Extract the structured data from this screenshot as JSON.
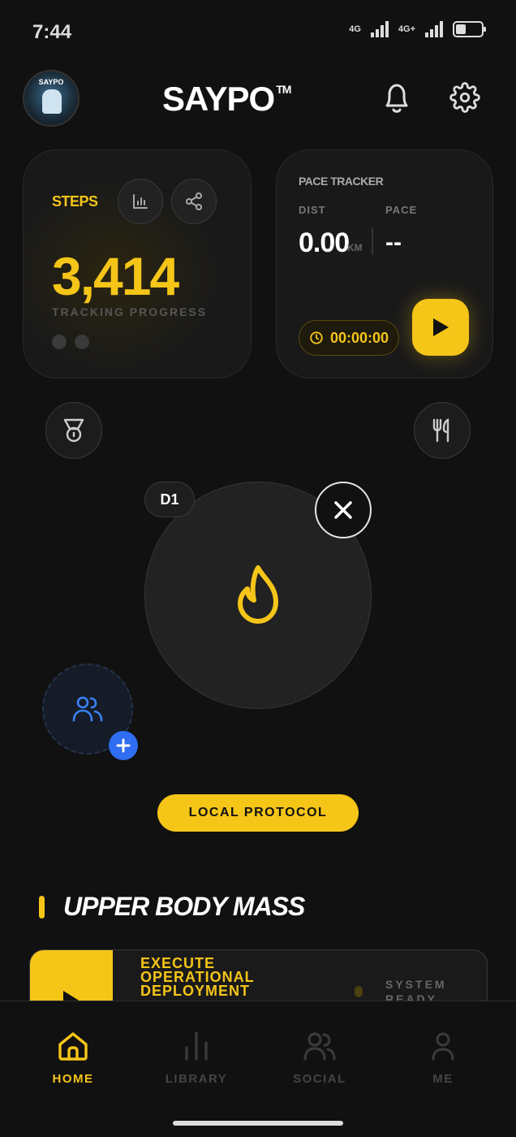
{
  "status_bar": {
    "time": "7:44",
    "network_1": "4G",
    "network_2": "4G+"
  },
  "header": {
    "avatar_text": "SAYPO",
    "brand": "SAYPO",
    "brand_mark": "TM",
    "icons": [
      "bell-icon",
      "gear-icon"
    ]
  },
  "steps_card": {
    "label": "STEPS",
    "value": "3,414",
    "sublabel": "TRACKING PROGRESS",
    "icons": [
      "bar-chart-icon",
      "share-icon"
    ]
  },
  "pace_card": {
    "title": "PACE TRACKER",
    "dist_label": "DIST",
    "pace_label": "PACE",
    "dist_value": "0.00",
    "dist_unit": "KM",
    "pace_value": "--",
    "timer": "00:00:00"
  },
  "challenge": {
    "day": "D1",
    "center_icon": "flame-icon"
  },
  "protocol_button": "LOCAL PROTOCOL",
  "section": {
    "title": "UPPER BODY MASS"
  },
  "workout_card": {
    "title": "EXECUTE OPERATIONAL DEPLOYMENT",
    "status": "SYSTEM READY"
  },
  "nav": {
    "items": [
      {
        "label": "HOME",
        "icon": "home-icon",
        "active": true
      },
      {
        "label": "LIBRARY",
        "icon": "library-icon",
        "active": false
      },
      {
        "label": "SOCIAL",
        "icon": "users-icon",
        "active": false
      },
      {
        "label": "ME",
        "icon": "user-icon",
        "active": false
      }
    ]
  },
  "colors": {
    "accent": "#f5c518",
    "background": "#111111",
    "card": "#191919",
    "blue": "#2f6df2"
  }
}
